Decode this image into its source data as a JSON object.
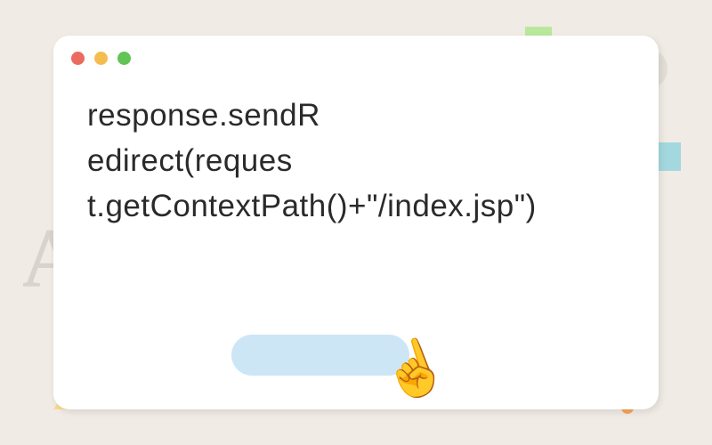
{
  "content": {
    "line1": "response.sendR",
    "line2": "edirect(reques",
    "line3": "t.getContextPath()+\"/index.jsp\")"
  },
  "decorations": {
    "cursor": "☝"
  }
}
